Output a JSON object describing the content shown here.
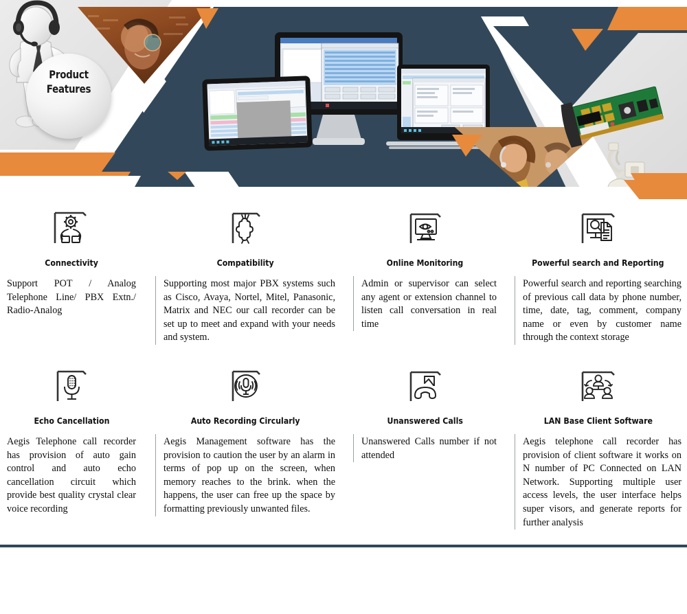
{
  "banner": {
    "title_line1": "Product",
    "title_line2": "Features",
    "colors": {
      "navy": "#32485a",
      "orange": "#e78a3c",
      "light_gray": "#e3e3e3",
      "brown": "#8a4a22",
      "white": "#ffffff"
    },
    "imagery": [
      "headset-mascot-illustration",
      "agent-with-headset-photo",
      "desktop-monitor-software-screenshot",
      "tablet-software-screenshot",
      "laptop-software-screenshot",
      "pci-voice-card-photo",
      "telephone-line-adapter-photo",
      "call-center-agents-photo"
    ]
  },
  "features": {
    "row1": [
      {
        "icon": "hands-holding-gear-icon",
        "title": "Connectivity",
        "body": "Support POT / Analog Telephone Line/ PBX Extn./ Radio-Analog"
      },
      {
        "icon": "puzzle-piece-icon",
        "title": "Compatibility",
        "body": "Supporting most major PBX systems such as Cisco, Avaya, Nortel, Mitel, Panasonic, Matrix and NEC our call recorder can be set up to meet and expand with your needs and system."
      },
      {
        "icon": "monitor-with-eye-icon",
        "title": "Online Monitoring",
        "body": "Admin or supervisor can select any agent or extension channel to listen call conversation in real time"
      },
      {
        "icon": "monitor-search-document-icon",
        "title": "Powerful search and Reporting",
        "body": "Powerful search and reporting searching of previous call data by phone number, time, date, tag, comment, company name or even by customer name through the context storage"
      }
    ],
    "row2": [
      {
        "icon": "microphone-icon",
        "title": "Echo Cancellation",
        "body": "Aegis Telephone call recorder has provision of auto gain control and auto echo cancellation circuit which provide best quality crystal clear voice recording"
      },
      {
        "icon": "circular-microphone-icon",
        "title": "Auto Recording Circularly",
        "body": "Aegis Management software has the provision to caution the user by an alarm in terms of pop up on the screen, when memory reaches to the brink. when the happens, the user can free up the space by formatting previously unwanted files."
      },
      {
        "icon": "missed-call-handset-icon",
        "title": "Unanswered Calls",
        "body": "Unanswered Calls number if not attended"
      },
      {
        "icon": "network-people-icon",
        "title": "LAN Base Client Software",
        "body": "Aegis telephone call recorder has provision of client software it works on N number of PC Connected on LAN Network. Supporting multiple user access levels, the user interface helps super visors, and generate reports for further analysis"
      }
    ]
  }
}
